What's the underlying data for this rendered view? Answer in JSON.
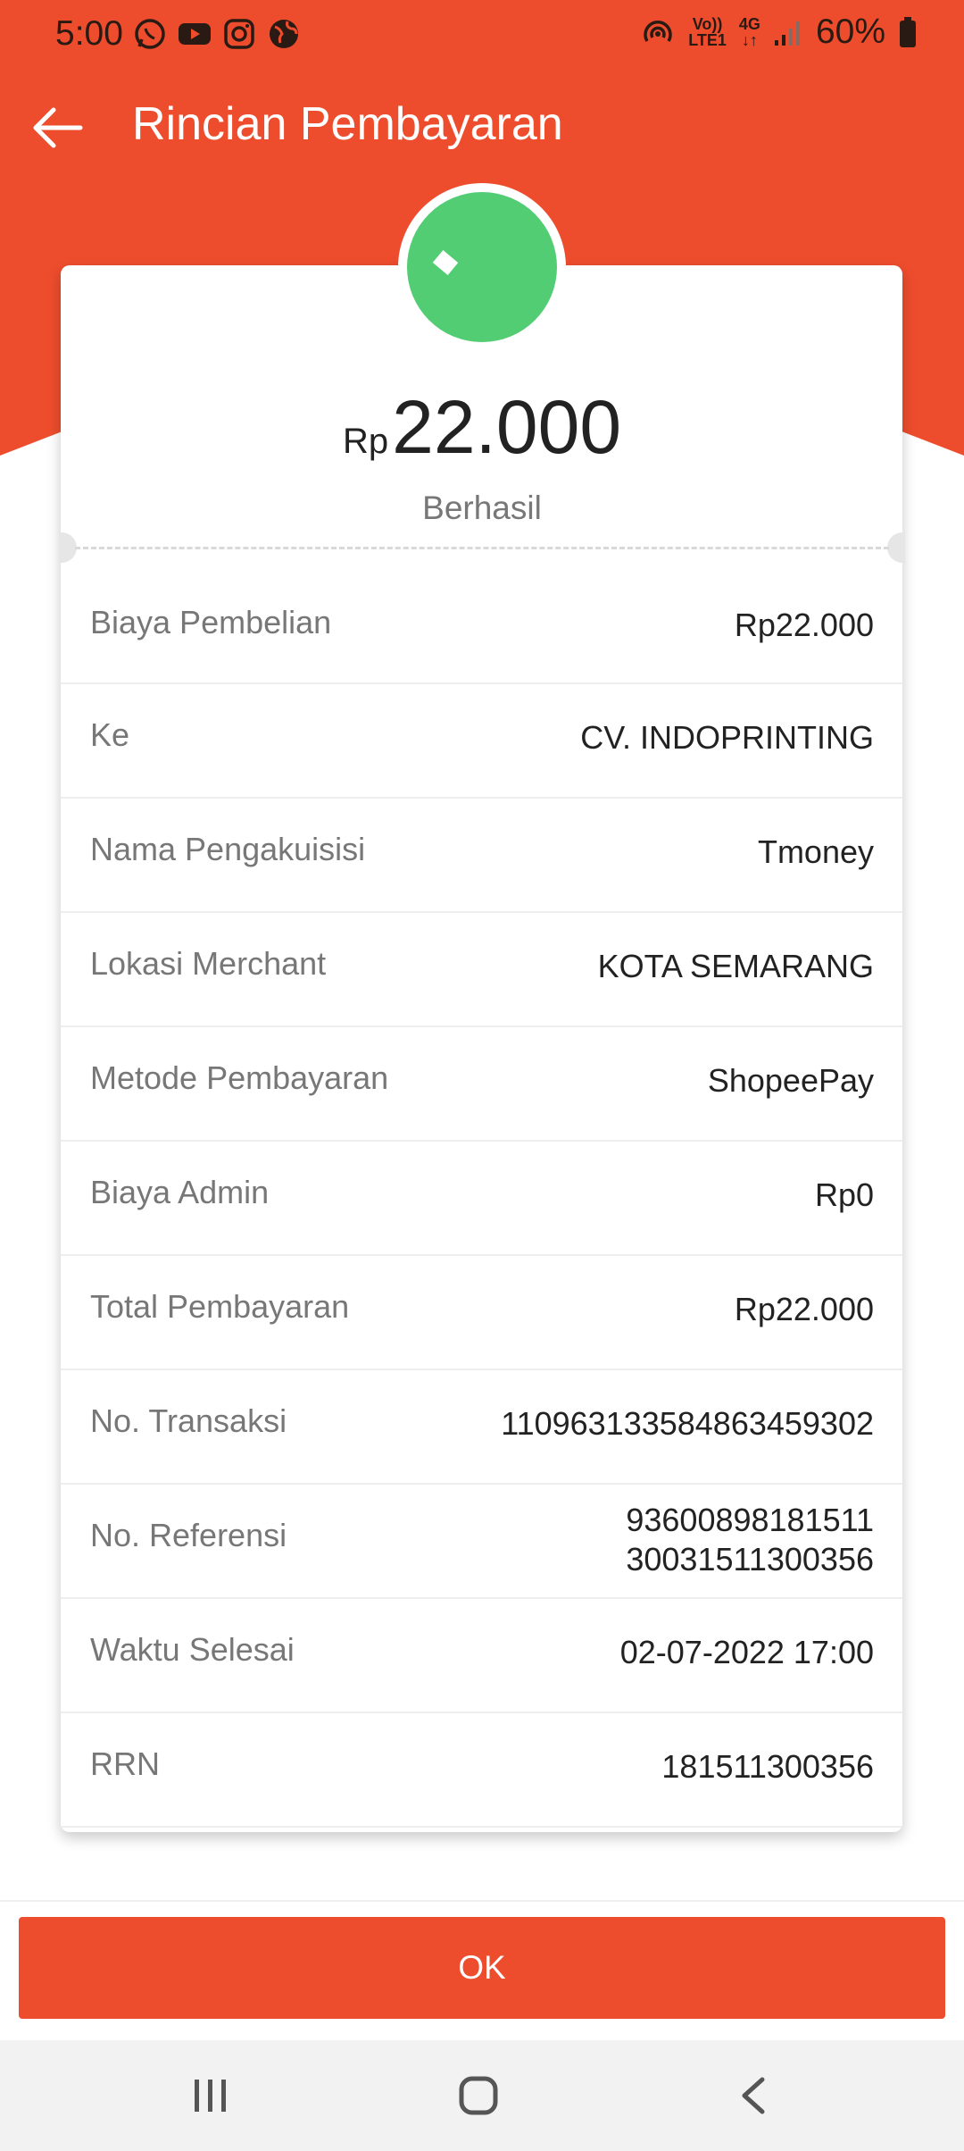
{
  "status_bar": {
    "time": "5:00",
    "app_icons": [
      "whatsapp-icon",
      "youtube-icon",
      "instagram-icon",
      "globe-icon"
    ],
    "network_top": "Vo))",
    "network_bottom": "LTE1",
    "signal_type": "4G",
    "battery": "60%"
  },
  "header": {
    "title": "Rincian Pembayaran"
  },
  "summary": {
    "currency": "Rp",
    "amount": "22.000",
    "status": "Berhasil"
  },
  "details": [
    {
      "label": "Biaya Pembelian",
      "value": "Rp22.000"
    },
    {
      "label": "Ke",
      "value": "CV. INDOPRINTING"
    },
    {
      "label": "Nama Pengakuisisi",
      "value": "Tmoney"
    },
    {
      "label": "Lokasi Merchant",
      "value": "KOTA SEMARANG"
    },
    {
      "label": "Metode Pembayaran",
      "value": "ShopeePay"
    },
    {
      "label": "Biaya Admin",
      "value": "Rp0"
    },
    {
      "label": "Total Pembayaran",
      "value": "Rp22.000"
    },
    {
      "label": "No. Transaksi",
      "value": "110963133584863459302"
    },
    {
      "label": "No. Referensi",
      "value_line1": "93600898181511",
      "value_line2": "30031511300356"
    },
    {
      "label": "Waktu Selesai",
      "value": "02-07-2022 17:00"
    },
    {
      "label": "RRN",
      "value": "181511300356"
    }
  ],
  "footer": {
    "ok_label": "OK"
  },
  "colors": {
    "brand": "#ee4d2d",
    "success": "#52cd73"
  }
}
